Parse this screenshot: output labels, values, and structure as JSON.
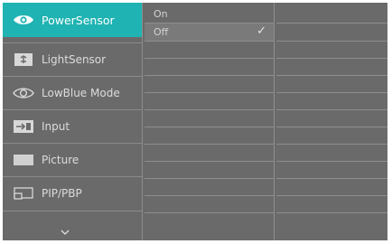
{
  "menu": {
    "items": [
      {
        "label": "PowerSensor",
        "icon": "eye-icon",
        "active": true
      },
      {
        "label": "LightSensor",
        "icon": "light-sensor-icon",
        "active": false
      },
      {
        "label": "LowBlue Mode",
        "icon": "eye-icon",
        "active": false
      },
      {
        "label": "Input",
        "icon": "input-icon",
        "active": false
      },
      {
        "label": "Picture",
        "icon": "picture-icon",
        "active": false
      },
      {
        "label": "PIP/PBP",
        "icon": "pip-icon",
        "active": false
      }
    ],
    "more_icon": "chevron-down-icon"
  },
  "options": {
    "items": [
      {
        "label": "On",
        "selected": false
      },
      {
        "label": "Off",
        "selected": true
      }
    ],
    "check_glyph": "✓"
  },
  "colors": {
    "panel": "#6a6a6a",
    "accent": "#1fb3b3",
    "text": "#dcdcdc"
  }
}
